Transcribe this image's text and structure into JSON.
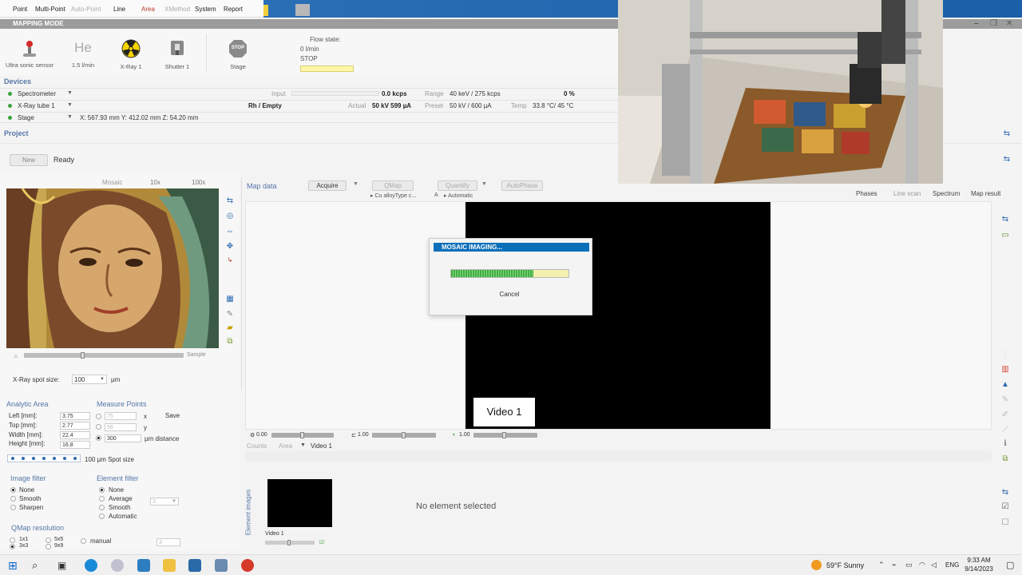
{
  "menu": {
    "items": [
      "Point",
      "Multi-Point",
      "Auto-Point",
      "Line",
      "Area",
      "XMethod",
      "System",
      "Report"
    ]
  },
  "window": {
    "title": "MAPPING MODE",
    "min": "–",
    "max": "❐",
    "close": "✕"
  },
  "top_controls": {
    "ultrasonic_label": "Ultra sonic sensor",
    "he_symbol": "He",
    "he_flow": "1.5 l/min",
    "xray_label": "X-Ray 1",
    "shutter_label": "Shutter 1",
    "stop_symbol": "STOP",
    "stage_label": "Stage",
    "flow_state_label": "Flow state:",
    "flow_value": "0 l/min",
    "flow_status": "STOP"
  },
  "devices": {
    "title": "Devices",
    "spectrometer": {
      "name": "Spectrometer",
      "input_label": "Input",
      "kcps": "0.0 kcps",
      "range_label": "Range",
      "range_value": "40 keV / 275 kcps",
      "percent": "0 %"
    },
    "xray_tube": {
      "name": "X-Ray tube 1",
      "target": "Rh / Empty",
      "actual_label": "Actual",
      "actual_value": "50 kV  599 µA",
      "preset_label": "Preset",
      "preset_value": "50 kV / 600 µA",
      "temp_label": "Temp",
      "temp_value": "33.8 °C/ 45 °C"
    },
    "stage": {
      "name": "Stage",
      "coords": "X: 567.93 mm   Y: 412.02 mm   Z: 54.20 mm"
    }
  },
  "project": {
    "title": "Project",
    "new_label": "New",
    "status": "Ready"
  },
  "image_panel": {
    "tabs": [
      "Mosaic",
      "10x",
      "100x"
    ],
    "sample_label": "Sample",
    "spot_size_label": "X-Ray spot size:",
    "spot_size_value": "100",
    "spot_unit": "µm"
  },
  "analytic_area": {
    "title": "Analytic Area",
    "left_label": "Left [mm]:",
    "left_value": "3.75",
    "top_label": "Top [mm]:",
    "top_value": "2.77",
    "width_label": "Width [mm]:",
    "width_value": "22.4",
    "height_label": "Height [mm]:",
    "height_value": "16.8"
  },
  "measure_points": {
    "title": "Measure Points",
    "x_value": "75",
    "x_label": "x",
    "y_value": "56",
    "y_label": "y",
    "distance_value": "300",
    "distance_label": "µm distance",
    "save_label": "Save",
    "spot_size_text": "100 µm   Spot size"
  },
  "image_filter": {
    "title": "Image filter",
    "options": [
      "None",
      "Smooth",
      "Sharpen"
    ]
  },
  "element_filter": {
    "title": "Element filter",
    "options": [
      "None",
      "Average",
      "Smooth",
      "Automatic"
    ],
    "value": "3"
  },
  "qmap": {
    "title": "QMap resolution",
    "opt1": "1x1",
    "opt2": "3x3",
    "opt3": "5x5",
    "opt4": "9x9",
    "manual_label": "manual",
    "manual_value": "3"
  },
  "map_data": {
    "title": "Map data",
    "acquire_label": "Acquire",
    "qmap_label": "QMap",
    "quantify_label": "Quantify",
    "autophase_label": "AutoPhase",
    "sub_left": "Cu alloyType c...",
    "sub_a": "A",
    "sub_auto": "Automatic",
    "tabs": [
      "Phases",
      "Line scan",
      "Spectrum",
      "Map result"
    ],
    "video_label": "Video 1",
    "slider1_value": "0.00",
    "slider2_value": "1.00",
    "slider3_value": "1.00",
    "sub_tabs": [
      "Counts",
      "Area",
      "Video 1"
    ]
  },
  "element_images": {
    "title": "Element images",
    "thumb_label": "Video 1",
    "empty_text": "No element selected"
  },
  "dialog": {
    "title": "MOSAIC IMAGING...",
    "progress": 0.7,
    "cancel_label": "Cancel"
  },
  "taskbar": {
    "weather": "59°F  Sunny",
    "lang": "ENG",
    "time": "9:33 AM",
    "date": "9/14/2023"
  }
}
